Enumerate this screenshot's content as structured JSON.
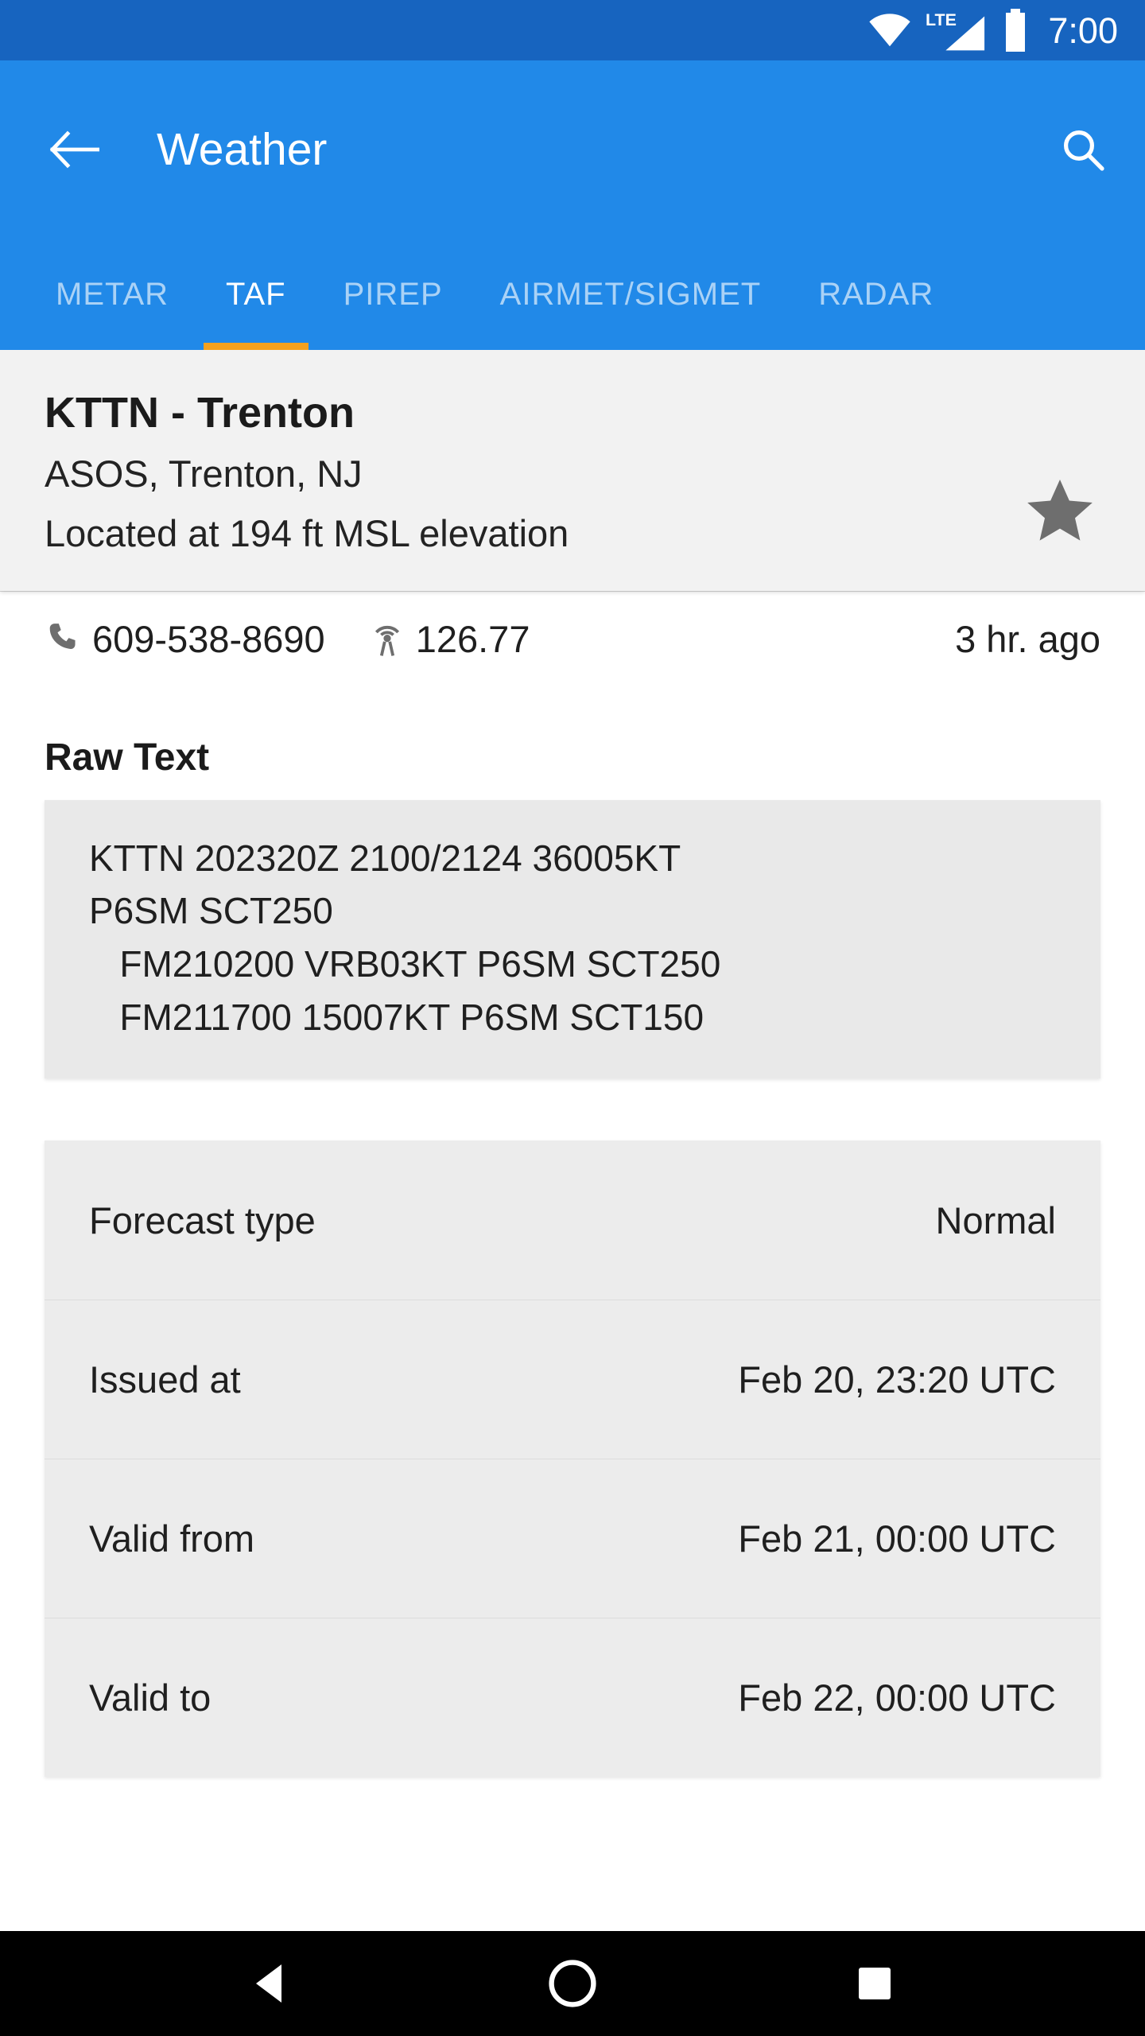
{
  "status_bar": {
    "network_label": "LTE",
    "time": "7:00",
    "icons": [
      "wifi-icon",
      "lte-signal-icon",
      "battery-icon"
    ],
    "background": "#1764bf"
  },
  "app_bar": {
    "title": "Weather",
    "back_icon": "back-arrow-icon",
    "search_icon": "search-icon",
    "background": "#2189e8"
  },
  "tabs": {
    "active_index": 1,
    "indicator_color": "#f5a11e",
    "items": [
      {
        "label": "METAR"
      },
      {
        "label": "TAF"
      },
      {
        "label": "PIREP"
      },
      {
        "label": "AIRMET/SIGMET"
      },
      {
        "label": "RADAR"
      }
    ]
  },
  "station": {
    "name": "KTTN - Trenton",
    "type_location": "ASOS, Trenton, NJ",
    "elevation": "Located at 194 ft MSL elevation",
    "favorite_icon": "star-filled-icon",
    "favorite_color": "#6e6e6e"
  },
  "info": {
    "phone_icon": "phone-icon",
    "phone": "609-538-8690",
    "frequency_icon": "radio-tower-icon",
    "frequency": "126.77",
    "age": "3 hr. ago"
  },
  "raw_text": {
    "heading": "Raw Text",
    "lines": [
      "KTTN 202320Z 2100/2124 36005KT",
      "P6SM SCT250",
      "   FM210200 VRB03KT P6SM SCT250",
      "   FM211700 15007KT P6SM SCT150"
    ]
  },
  "details": {
    "rows": [
      {
        "label": "Forecast type",
        "value": "Normal"
      },
      {
        "label": "Issued at",
        "value": "Feb 20, 23:20 UTC"
      },
      {
        "label": "Valid from",
        "value": "Feb 21, 00:00 UTC"
      },
      {
        "label": "Valid to",
        "value": "Feb 22, 00:00 UTC"
      }
    ]
  },
  "nav_bar": {
    "back_icon": "nav-back-triangle-icon",
    "home_icon": "nav-home-circle-icon",
    "recents_icon": "nav-recents-square-icon"
  }
}
